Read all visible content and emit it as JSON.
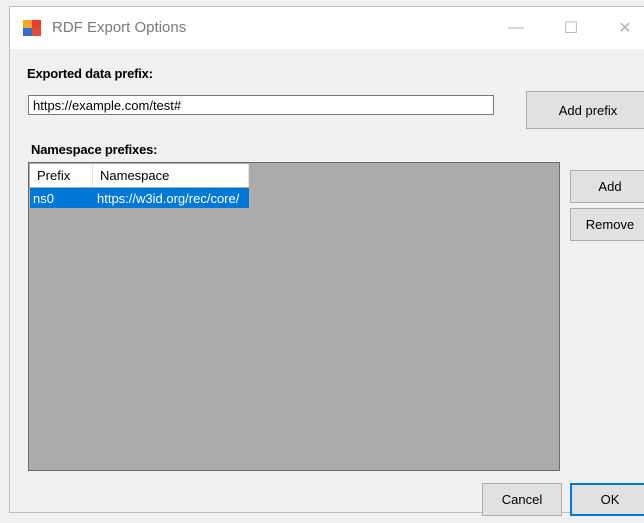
{
  "window": {
    "title": "RDF Export Options",
    "minimize_glyph": "—",
    "maximize_glyph": "☐",
    "close_glyph": "✕"
  },
  "export": {
    "label": "Exported data prefix:",
    "value": "https://example.com/test#",
    "add_prefix_label": "Add prefix"
  },
  "namespaces": {
    "label": "Namespace prefixes:",
    "columns": [
      "Prefix",
      "Namespace"
    ],
    "rows": [
      {
        "prefix": "ns0",
        "namespace": "https://w3id.org/rec/core/",
        "selected": true
      }
    ],
    "add_label": "Add",
    "remove_label": "Remove"
  },
  "footer": {
    "cancel_label": "Cancel",
    "ok_label": "OK"
  },
  "colors": {
    "selection": "#0078d7",
    "list_background": "#ababab",
    "window_background": "#f0f0f0"
  },
  "icons": {
    "app": "rdf-app-icon"
  }
}
